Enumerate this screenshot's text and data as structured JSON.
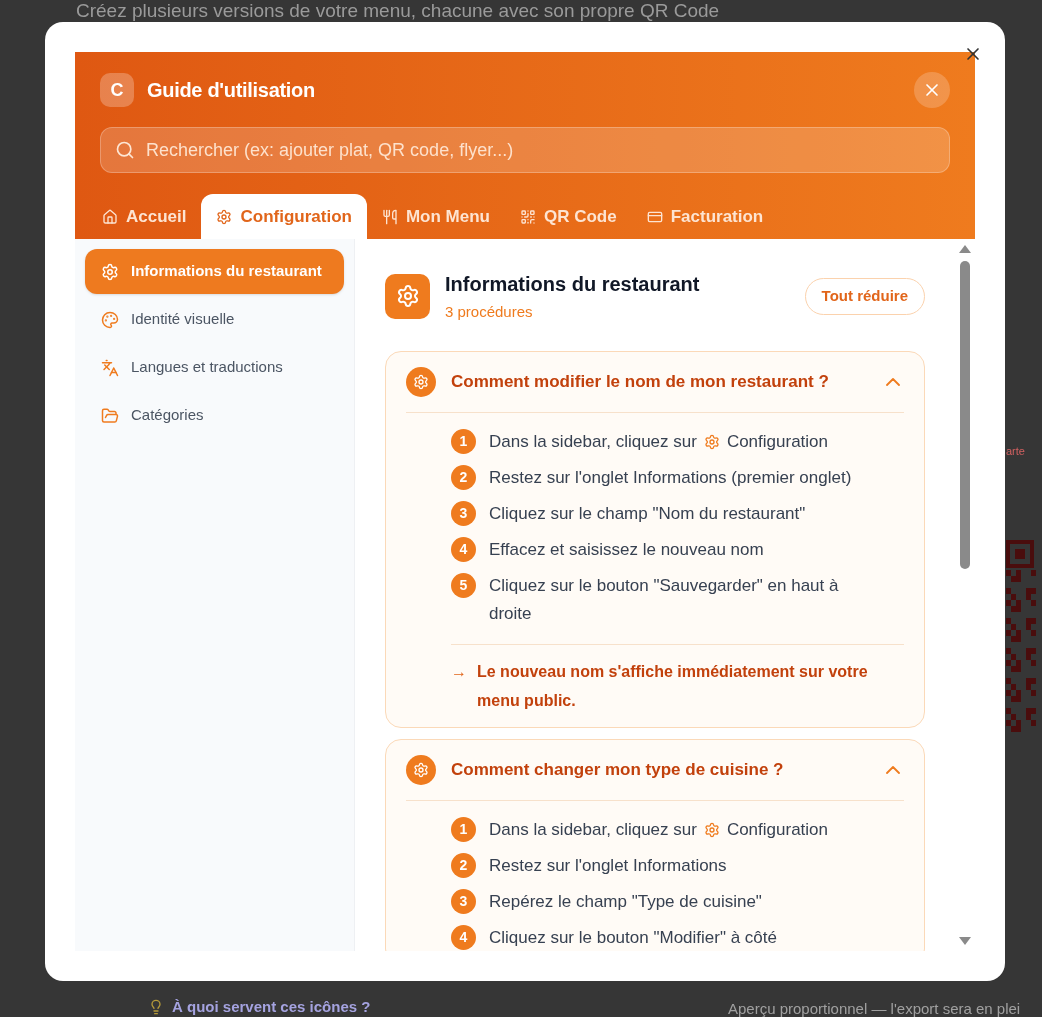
{
  "backdrop": {
    "heading": "Créez plusieurs versions de votre menu, chacune avec son propre QR Code",
    "side_label": "arte",
    "help_link": "À quoi servent ces icônes ?",
    "preview_note": "Aperçu proportionnel — l'export sera en plei"
  },
  "guide": {
    "logo": "C",
    "title": "Guide d'utilisation",
    "search": {
      "placeholder": "Rechercher (ex: ajouter plat, QR code, flyer...)"
    },
    "tabs": [
      {
        "label": "Accueil",
        "selected": false
      },
      {
        "label": "Configuration",
        "selected": true
      },
      {
        "label": "Mon Menu",
        "selected": false
      },
      {
        "label": "QR Code",
        "selected": false
      },
      {
        "label": "Facturation",
        "selected": false
      }
    ],
    "sidebar": [
      {
        "label": "Informations du restaurant",
        "selected": true
      },
      {
        "label": "Identité visuelle",
        "selected": false
      },
      {
        "label": "Langues et traductions",
        "selected": false
      },
      {
        "label": "Catégories",
        "selected": false
      }
    ],
    "section": {
      "title": "Informations du restaurant",
      "count": "3 procédures",
      "collapse_button": "Tout réduire"
    },
    "procedures": [
      {
        "question": "Comment modifier le nom de mon restaurant ?",
        "expanded": true,
        "steps": [
          {
            "number": "1",
            "text": "Dans la sidebar, cliquez sur",
            "target": "Configuration"
          },
          {
            "number": "2",
            "text": "Restez sur l'onglet Informations (premier onglet)"
          },
          {
            "number": "3",
            "text": "Cliquez sur le champ \"Nom du restaurant\""
          },
          {
            "number": "4",
            "text": "Effacez et saisissez le nouveau nom"
          },
          {
            "number": "5",
            "text": "Cliquez sur le bouton \"Sauvegarder\" en haut à droite"
          }
        ],
        "result_arrow": "→",
        "result": "Le nouveau nom s'affiche immédiatement sur votre menu public."
      },
      {
        "question": "Comment changer mon type de cuisine ?",
        "expanded": true,
        "steps": [
          {
            "number": "1",
            "text": "Dans la sidebar, cliquez sur",
            "target": "Configuration"
          },
          {
            "number": "2",
            "text": "Restez sur l'onglet Informations"
          },
          {
            "number": "3",
            "text": "Repérez le champ \"Type de cuisine\""
          },
          {
            "number": "4",
            "text": "Cliquez sur le bouton \"Modifier\" à côté"
          }
        ]
      }
    ]
  }
}
